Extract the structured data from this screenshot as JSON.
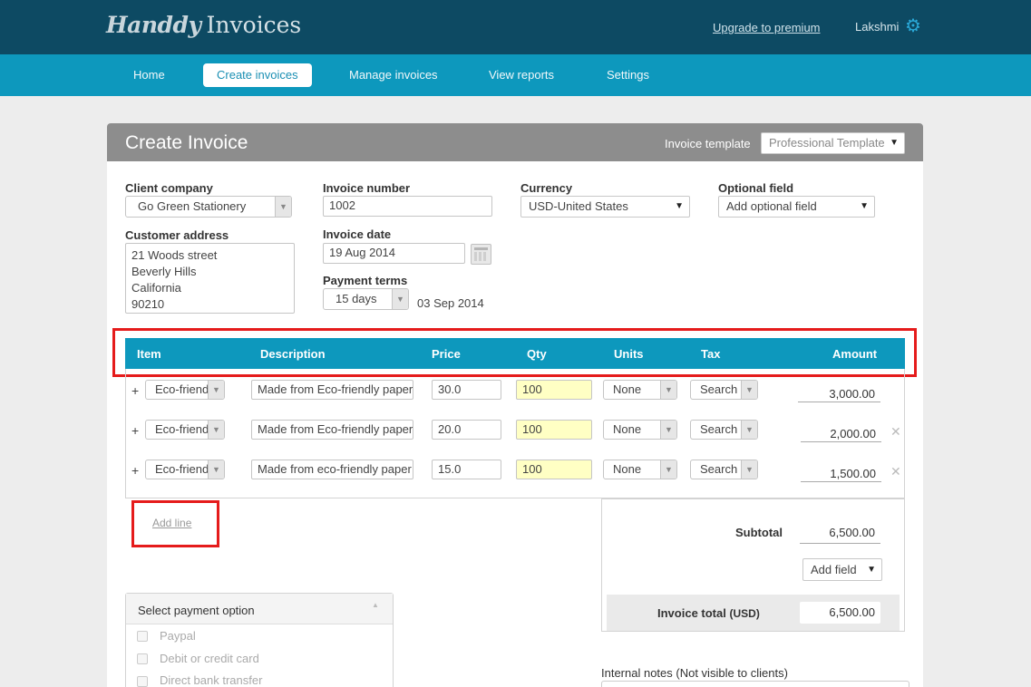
{
  "brand": {
    "script": "Handdy",
    "name": "Invoices"
  },
  "header": {
    "upgrade_label": "Upgrade to premium",
    "user_name": "Lakshmi",
    "settings_icon": "gear-icon"
  },
  "nav": {
    "home": "Home",
    "create": "Create invoices",
    "manage": "Manage invoices",
    "reports": "View reports",
    "settings": "Settings",
    "active": "Create invoices"
  },
  "page": {
    "title": "Create Invoice",
    "template_label": "Invoice template",
    "template_value": "Professional Template"
  },
  "form": {
    "client_company_label": "Client company",
    "client_company_value": "Go Green Stationery",
    "customer_address_label": "Customer address",
    "customer_address_lines": [
      "21 Woods street",
      "Beverly Hills",
      "California",
      "90210"
    ],
    "invoice_number_label": "Invoice number",
    "invoice_number_value": "1002",
    "invoice_date_label": "Invoice date",
    "invoice_date_value": "19 Aug 2014",
    "payment_terms_label": "Payment terms",
    "payment_terms_value": "15 days",
    "due_date": "03 Sep 2014",
    "currency_label": "Currency",
    "currency_value": "USD-United States",
    "optional_field_label": "Optional field",
    "optional_field_value": "Add optional field"
  },
  "table": {
    "columns": {
      "item": "Item",
      "description": "Description",
      "price": "Price",
      "qty": "Qty",
      "units": "Units",
      "tax": "Tax",
      "amount": "Amount"
    },
    "rows": [
      {
        "item": "Eco-friendly",
        "description": "Made from Eco-friendly paper",
        "price": "30.0",
        "qty": "100",
        "units": "None",
        "tax": "Search",
        "amount": "3,000.00"
      },
      {
        "item": "Eco-friendly",
        "description": "Made from Eco-friendly paper",
        "price": "20.0",
        "qty": "100",
        "units": "None",
        "tax": "Search",
        "amount": "2,000.00"
      },
      {
        "item": "Eco-friendly",
        "description": "Made from eco-friendly paper",
        "price": "15.0",
        "qty": "100",
        "units": "None",
        "tax": "Search",
        "amount": "1,500.00"
      }
    ],
    "add_line_label": "Add line"
  },
  "totals": {
    "subtotal_label": "Subtotal",
    "subtotal_value": "6,500.00",
    "add_field_label": "Add field",
    "invoice_total_label": "Invoice total",
    "currency_suffix": "(USD)",
    "invoice_total_value": "6,500.00"
  },
  "payment": {
    "title": "Select payment option",
    "options": [
      "Paypal",
      "Debit or credit card",
      "Direct bank transfer"
    ]
  },
  "notes": {
    "internal_label": "Internal notes (Not visible to clients)"
  },
  "colors": {
    "topbar": "#0d4a63",
    "nav": "#0d98bd",
    "card_header": "#8d8d8d",
    "highlight": "#e51b1b",
    "qty_bg": "#ffffc4"
  }
}
